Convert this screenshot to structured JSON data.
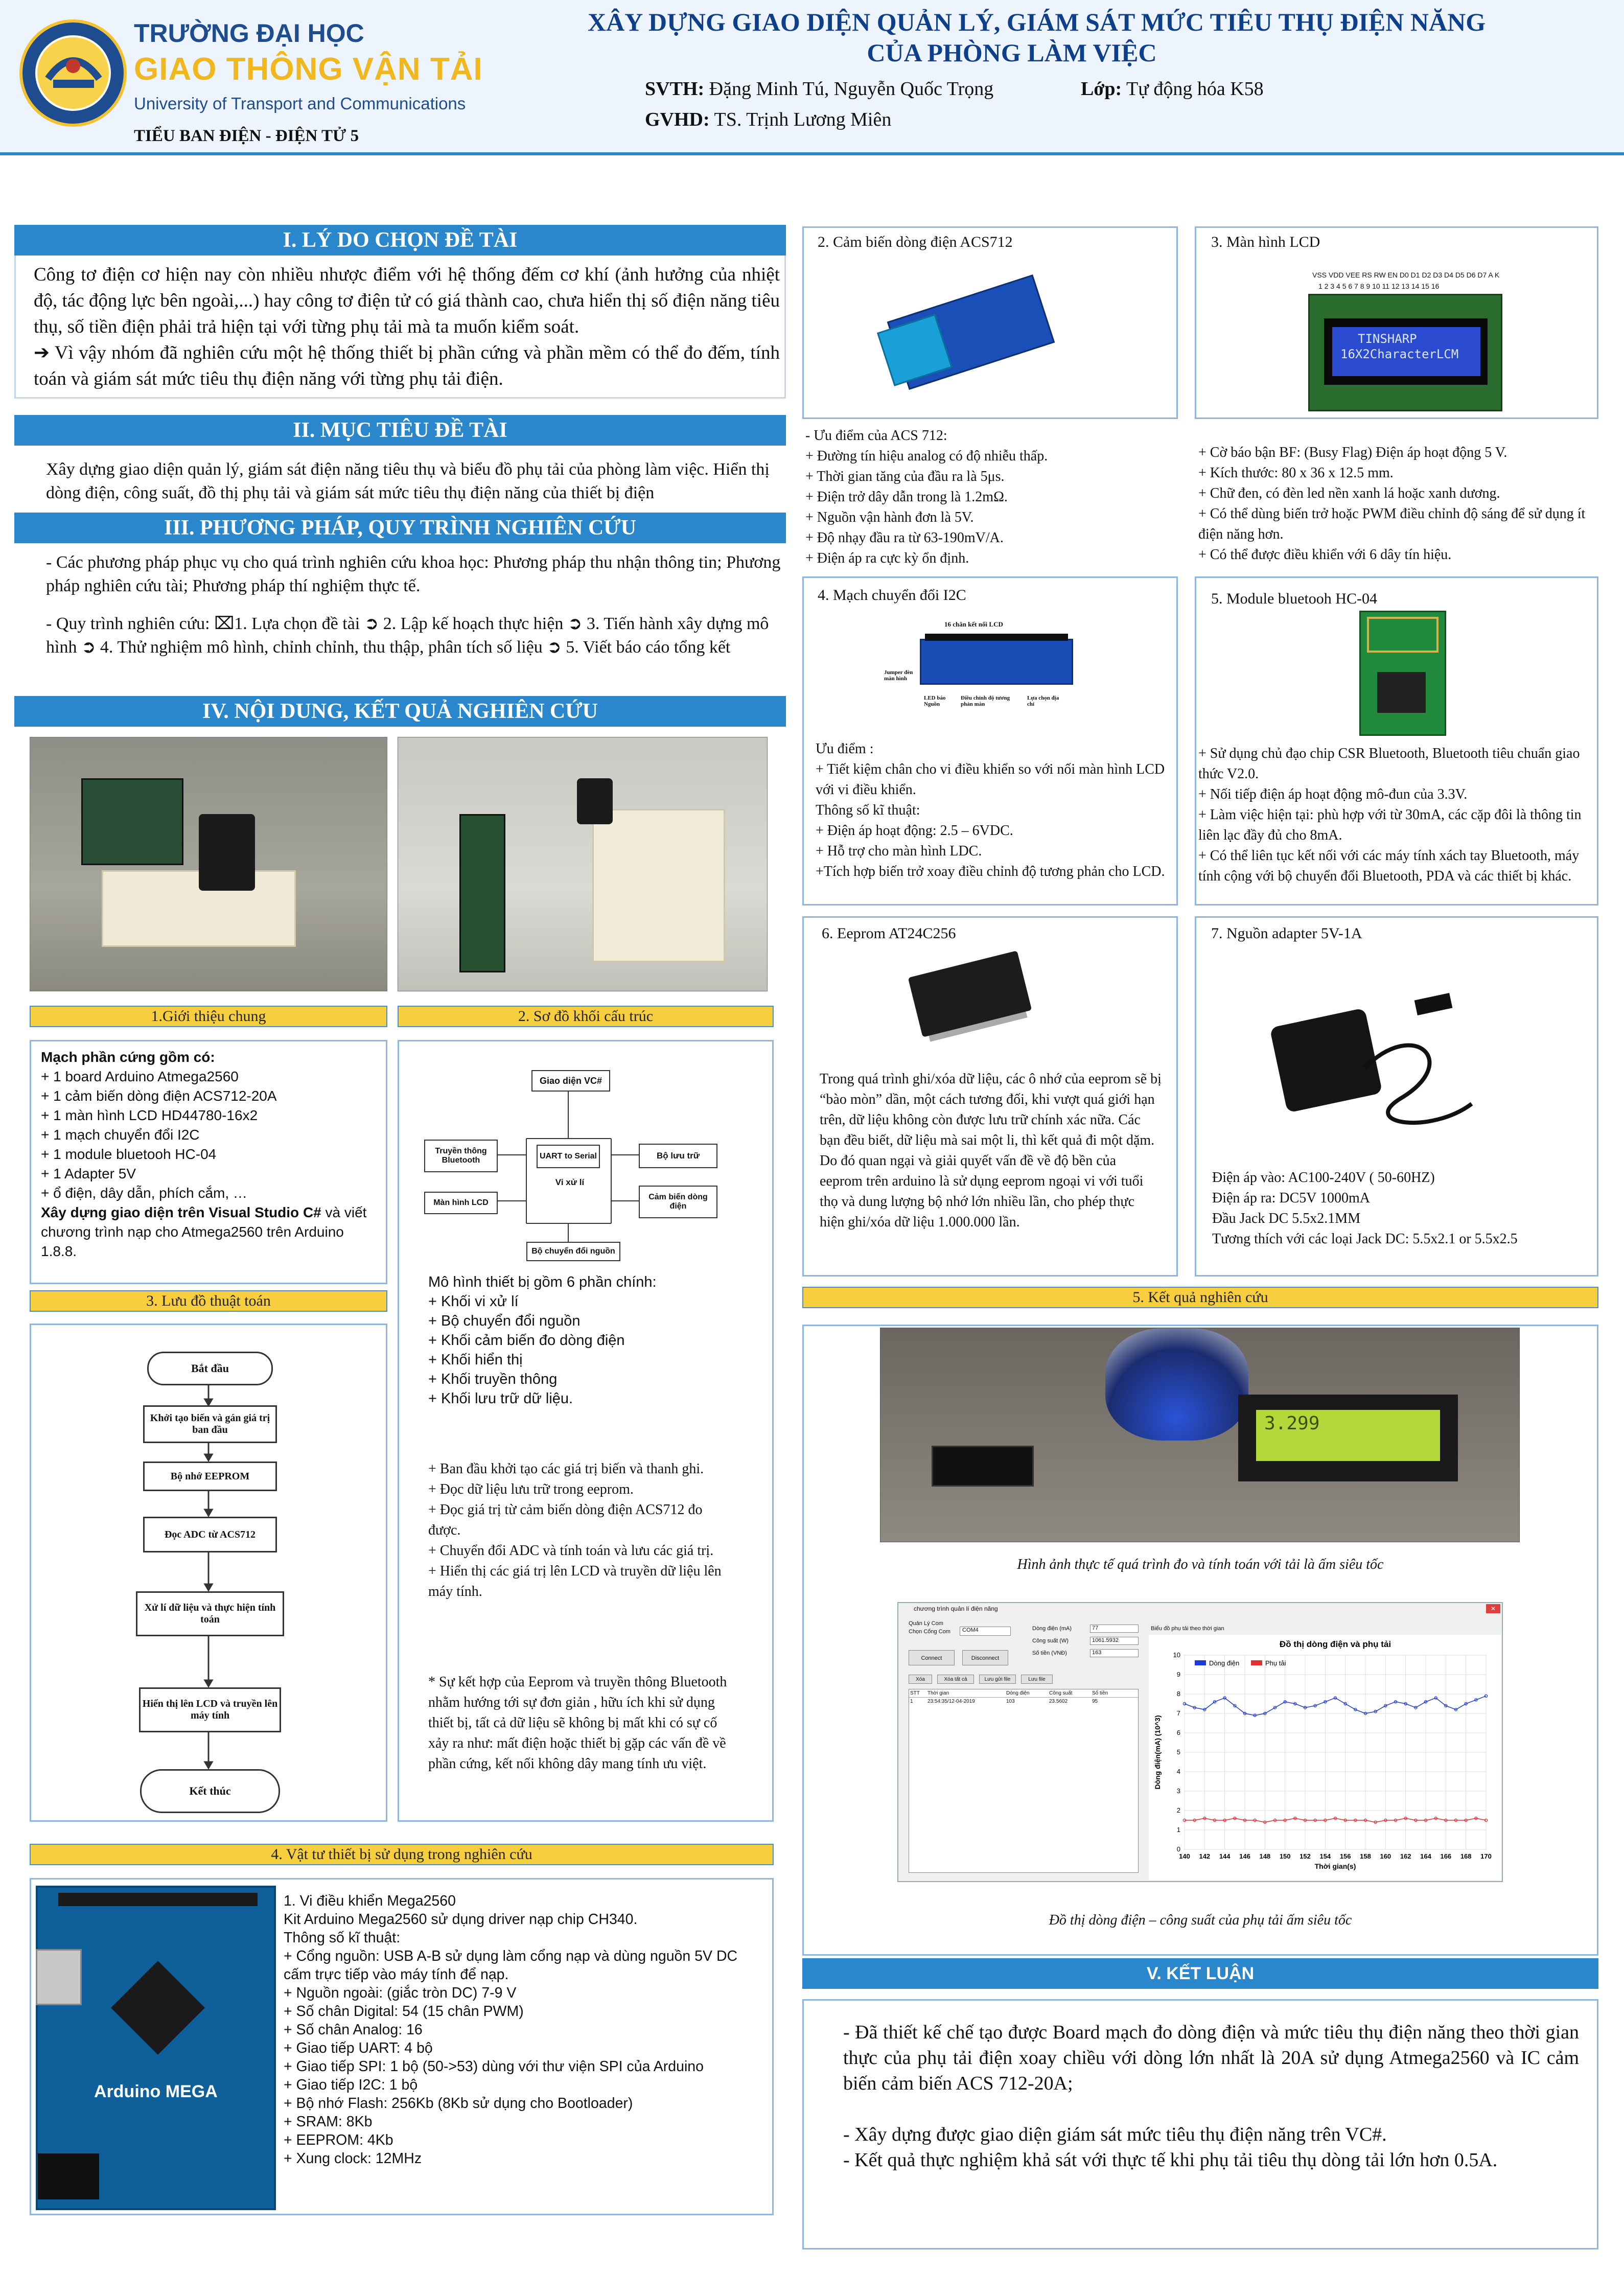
{
  "header": {
    "uni_line1": "TRƯỜNG ĐẠI HỌC",
    "uni_line2": "GIAO THÔNG VẬN TẢI",
    "uni_line3": "University of Transport and Communications",
    "subcommittee": "TIỂU BAN ĐIỆN - ĐIỆN TỬ 5",
    "title_line1": "XÂY DỰNG GIAO DIỆN QUẢN LÝ, GIÁM SÁT MỨC TIÊU THỤ ĐIỆN NĂNG",
    "title_line2": "CỦA PHÒNG LÀM VIỆC",
    "svth_label": "SVTH:",
    "svth_value": "Đặng Minh Tú, Nguyễn Quốc Trọng",
    "lop_label": "Lớp:",
    "lop_value": "Tự động hóa K58",
    "gvhd_label": "GVHD:",
    "gvhd_value": "TS. Trịnh Lương Miên",
    "seal_text": "TRƯỜNG ĐẠI HỌC GIAO THÔNG VẬN TẢI · UNIVERSITY OF TRANSPORT AND COMMUNICATIONS",
    "accent_color": "#2a87cc",
    "header_bg": "#eef4fb"
  },
  "section1": {
    "heading": "I. LÝ DO CHỌN ĐỀ TÀI",
    "para1": "Công tơ điện cơ hiện nay còn nhiều nhược điểm với hệ thống đếm cơ khí (ảnh hưởng của nhiệt độ, tác động lực bên ngoài,...) hay công tơ điện tử có giá thành cao, chưa hiển thị số điện năng tiêu thụ, số tiền điện phải trả hiện tại với từng phụ tải mà ta muốn kiểm soát.",
    "arrow": "➔",
    "para2": " Vì vậy nhóm đã nghiên cứu một hệ thống thiết bị phần cứng và phần mềm có thể đo đếm, tính toán và giám sát mức tiêu thụ điện năng với từng phụ tải điện."
  },
  "section2": {
    "heading": "II. MỤC TIÊU ĐỀ TÀI",
    "text": "Xây dựng giao diện quản lý, giám sát điện năng tiêu thụ và biểu đồ phụ tải của phòng làm việc. Hiển thị dòng điện, công suất, đồ thị phụ tải và giám sát mức tiêu thụ điện năng của thiết bị điện"
  },
  "section3": {
    "heading": "III. PHƯƠNG PHÁP, QUY TRÌNH NGHIÊN CỨU",
    "para1": "- Các phương pháp phục vụ cho quá trình nghiên cứu khoa học: Phương pháp thu nhận thông tin; Phương pháp nghiên cứu tài; Phương pháp thí nghiệm thực tế.",
    "para2": "- Quy trình nghiên cứu: ⌧1. Lựa chọn đề tài  ➲ 2. Lập kế hoạch thực hiện  ➲ 3. Tiến hành xây dựng mô hình  ➲ 4. Thử nghiệm mô hình, chỉnh chỉnh, thu thập, phân tích số liệu  ➲ 5. Viết báo cáo tổng kết"
  },
  "section4": {
    "heading": "IV. NỘI DUNG, KẾT QUẢ NGHIÊN CỨU"
  },
  "intro": {
    "bar": "1.Giới thiệu chung",
    "title": "Mạch phần cứng gồm có:",
    "items": "+ 1 board Arduino Atmega2560\n+ 1 cảm biến dòng điện ACS712-20A\n+ 1 màn hình LCD HD44780-16x2\n+ 1 mạch chuyển đổi I2C\n+ 1 module bluetooh HC-04\n+ 1 Adapter 5V\n+ ổ điện, dây dẫn, phích cắm, …",
    "bold": "Xây dựng giao diện trên Visual Studio C#",
    "tail": " và viết chương trình nạp cho Atmega2560 trên Arduino 1.8.8."
  },
  "block": {
    "bar": "2. Sơ đồ khối cấu trúc",
    "box_ui": "Giao diện VC#",
    "box_bt": "Truyền thông Bluetooth",
    "box_uart": "UART to Serial",
    "box_mem": "Bộ lưu trữ",
    "box_cpu": "Vi xử lí",
    "box_lcd": "Màn hình LCD",
    "box_sensor": "Cảm biến dòng điện",
    "box_power": "Bộ chuyển đổi nguồn",
    "model_text": "Mô hình thiết bị gồm 6 phần chính:\n+ Khối vi xử lí\n+ Bộ chuyển đổi nguồn\n+ Khối cảm biến đo dòng điện\n+ Khối hiển thị\n+ Khối truyền thông\n+ Khối lưu trữ dữ liệu.",
    "steps": "+ Ban đầu khởi tạo các giá trị biến và thanh ghi.\n+ Đọc dữ liệu lưu trữ trong eeprom.\n+ Đọc giá trị từ cảm biến dòng điện ACS712 đo được.\n+ Chuyển đổi ADC và tính toán và lưu các giá trị.\n+ Hiển thị các giá trị lên LCD và truyền dữ liệu lên máy tính.",
    "note": "     * Sự kết hợp của Eeprom và truyền thông Bluetooth nhằm hướng tới sự đơn giản , hữu ích khi sử dụng thiết bị, tất cả dữ liệu sẽ không bị mất khi có sự cố xảy ra như: mất điện hoặc thiết bị gặp các vấn đề về phần cứng, kết nối không dây mang tính ưu việt."
  },
  "flow": {
    "bar": "3. Lưu đồ thuật toán",
    "start": "Bắt đầu",
    "init": "Khởi tạo biến và gán giá trị ban đầu",
    "eeprom": "Bộ nhớ EEPROM",
    "adc": "Đọc ADC từ ACS712",
    "proc": "Xử lí dữ liệu và thực hiện tính toán",
    "display": "Hiển thị lên LCD và truyền lên máy tính",
    "end": "Kết thúc"
  },
  "materials": {
    "bar": "4. Vật tư thiết bị sử dụng trong nghiên cứu",
    "board_label": "Arduino MEGA",
    "text": "1. Vi điều khiển Mega2560\nKit Arduino Mega2560 sử dụng driver nạp chip CH340.\nThông số kĩ thuật:\n+ Cổng nguồn: USB A-B sử dụng làm cổng nạp và dùng nguồn 5V DC cấm trực tiếp vào máy tính để nạp.\n+ Nguồn ngoài: (giắc tròn DC) 7-9 V\n+ Số chân Digital: 54 (15 chân PWM)\n+ Số chân Analog: 16\n+ Giao tiếp UART: 4 bộ\n+ Giao tiếp SPI: 1 bộ (50->53) dùng với thư viện SPI của Arduino\n+ Giao tiếp I2C: 1 bộ\n+ Bộ nhớ Flash: 256Kb (8Kb sử dụng cho Bootloader)\n+ SRAM: 8Kb\n+ EEPROM: 4Kb\n+ Xung clock: 12MHz"
  },
  "acs": {
    "caption": "2. Cảm biến dòng điện ACS712",
    "text": "- Ưu điểm của ACS 712:\n+ Đường tín hiệu analog có độ nhiễu thấp.\n+ Thời gian tăng của đầu ra là 5μs.\n+ Điện trở dây dẫn trong là 1.2mΩ.\n+ Nguồn vận hành đơn là 5V.\n+ Độ nhạy đầu ra từ 63-190mV/A.\n+ Điện áp ra cực kỳ ổn định."
  },
  "lcd": {
    "caption": "3. Màn hình LCD",
    "pins": "VSS VDD VEE RS RW EN D0 D1 D2 D3 D4 D5 D6 D7 A K",
    "nums": "1  2  3  4  5  6  7  8  9  10 11 12 13 14 15 16",
    "screen_l1": "TINSHARP",
    "screen_l2": "16X2CharacterLCM",
    "text": "+ Cờ báo bận BF: (Busy Flag) Điện áp hoạt động 5 V.\n+ Kích thước: 80 x 36 x 12.5 mm.\n+ Chữ đen, có đèn led nền xanh lá hoặc xanh dương.\n+ Có thể dùng biến trở hoặc PWM điều chỉnh độ sáng để sử dụng ít điện năng hơn.\n+ Có thể được điều khiển với 6 dây tín hiệu."
  },
  "i2c": {
    "caption": "4. Mạch chuyển đổi I2C",
    "board_title": "16 chân kết nối LCD",
    "lbl1": "Jumper đèn màn hình",
    "lbl2": "LED báo Nguồn",
    "lbl3": "Điều chỉnh độ tương phản màn",
    "lbl4": "Lựa chọn địa chỉ",
    "text": "Ưu điểm :\n+ Tiết kiệm chân cho vi điều khiển so với nối màn hình LCD với vi điều khiển.\n Thông số kĩ thuật:\n+ Điện áp hoạt động: 2.5 – 6VDC.\n+ Hỗ trợ cho màn hình LDC.\n+Tích hợp biến trở xoay điều chỉnh độ tương phản cho LCD."
  },
  "bt": {
    "caption": "5. Module bluetooh HC-04",
    "text": "+ Sử dụng chủ đạo chip CSR Bluetooth, Bluetooth tiêu chuẩn giao thức V2.0.\n+ Nối tiếp điện áp hoạt động mô-đun của 3.3V.\n+  Làm việc hiện tại: phù hợp với từ 30mA, các cặp đôi là thông tin liên lạc đầy đủ cho 8mA.\n+ Có thể liên tục kết nối với các máy tính xách tay Bluetooth, máy tính cộng với bộ chuyển đổi Bluetooth, PDA và các thiết bị khác."
  },
  "eeprom": {
    "caption": "6. Eeprom AT24C256",
    "text": "Trong quá trình ghi/xóa dữ liệu, các ô nhớ của eeprom sẽ bị “bào mòn” dần, một cách tương đối, khi vượt quá giới hạn trên, dữ liệu không còn được lưu trữ chính xác nữa. Các bạn đều biết, dữ liệu mà sai một li, thì kết quả đi một dặm. Do đó quan ngại và giải quyết vấn đề về độ bền của eeprom trên arduino là sử dụng eeprom ngoại vi với tuổi thọ và dung lượng bộ nhớ lớn nhiều lần, cho phép thực hiện ghi/xóa dữ liệu 1.000.000 lần."
  },
  "adapter": {
    "caption": "7. Nguồn adapter 5V-1A",
    "text": "Điện áp vào: AC100-240V ( 50-60HZ)\nĐiện áp ra: DC5V 1000mA\nĐầu Jack DC 5.5x2.1MM\nTương thích với các loại Jack DC: 5.5x2.1 or 5.5x2.5"
  },
  "result": {
    "bar": "5. Kết quả nghiên cứu",
    "lcd_text": "3.299",
    "photo_caption": "Hình ảnh thực tế quá trình đo và tính toán với tải là ấm siêu tốc",
    "chart_caption": "Đồ thị dòng điện – công suất của phụ tải ấm siêu tốc"
  },
  "app": {
    "window_title": "chương trình quản lí điện năng",
    "group": "Quản Lý Com",
    "port_label": "Chọn Cổng Com",
    "port_value": "COM4",
    "connect": "Connect",
    "disconnect": "Disconnect",
    "lbl_current": "Dòng điện (mA)",
    "val_current": "77",
    "lbl_power": "Công suất (W)",
    "val_power": "1061.5932",
    "lbl_money": "Số tiền (VNĐ)",
    "val_money": "163",
    "chart_btn": "Biểu đồ phụ tải theo thời gian",
    "btn_xoa": "Xóa",
    "btn_xoa_het": "Xóa tất cả",
    "btn_luu": "Lưu gửi file",
    "btn_luufile": "Lưu file",
    "table_headers": [
      "STT",
      "Thời gian",
      "Dòng điện",
      "Công suất",
      "Số tiền"
    ],
    "table_row": [
      "1",
      "23:54:35/12-04-2019",
      "103",
      "23.5602",
      "95"
    ]
  },
  "chart_data": {
    "type": "line",
    "title": "Đồ thị dòng điện và phụ tải",
    "xlabel": "Thời gian(s)",
    "ylabel": "Dòng điện(mA) (10^3)",
    "ylim": [
      0,
      10
    ],
    "xlim": [
      140,
      170
    ],
    "xticks": [
      "140",
      "142",
      "144",
      "146",
      "148",
      "150",
      "152",
      "154",
      "156",
      "158",
      "160",
      "162",
      "164",
      "166",
      "168",
      "170"
    ],
    "yticks": [
      "0",
      "1",
      "2",
      "3",
      "4",
      "5",
      "6",
      "7",
      "8",
      "9",
      "10"
    ],
    "grid": true,
    "legend": "top-left",
    "x": [
      140,
      141,
      142,
      143,
      144,
      145,
      146,
      147,
      148,
      149,
      150,
      151,
      152,
      153,
      154,
      155,
      156,
      157,
      158,
      159,
      160,
      161,
      162,
      163,
      164,
      165,
      166,
      167,
      168,
      169,
      170
    ],
    "series": [
      {
        "name": "Dòng điện",
        "color": "#1f3bd6",
        "values": [
          7.5,
          7.3,
          7.2,
          7.6,
          7.8,
          7.4,
          7.0,
          6.9,
          7.0,
          7.3,
          7.6,
          7.5,
          7.3,
          7.4,
          7.6,
          7.8,
          7.5,
          7.2,
          7.0,
          7.1,
          7.4,
          7.6,
          7.5,
          7.3,
          7.6,
          7.8,
          7.4,
          7.2,
          7.5,
          7.7,
          7.9
        ]
      },
      {
        "name": "Phụ tải",
        "color": "#e03030",
        "values": [
          1.5,
          1.5,
          1.6,
          1.5,
          1.5,
          1.6,
          1.5,
          1.5,
          1.4,
          1.5,
          1.5,
          1.6,
          1.5,
          1.5,
          1.5,
          1.6,
          1.5,
          1.5,
          1.5,
          1.4,
          1.5,
          1.5,
          1.6,
          1.5,
          1.5,
          1.6,
          1.5,
          1.5,
          1.5,
          1.6,
          1.5
        ]
      }
    ]
  },
  "conclusion": {
    "heading": "V. KẾT LUẬN",
    "text": "- Đã thiết kế chế tạo được Board mạch đo dòng điện và mức tiêu thụ điện năng theo thời gian thực của phụ tải điện xoay chiều với dòng lớn nhất là 20A sử dụng Atmega2560 và IC cảm biến cảm biến ACS 712-20A;\n\n- Xây dựng được giao diện giám sát mức tiêu thụ điện năng trên VC#.\n- Kết quả thực nghiệm khả sát với thực tế khi phụ tải tiêu thụ dòng tải lớn hơn 0.5A."
  }
}
